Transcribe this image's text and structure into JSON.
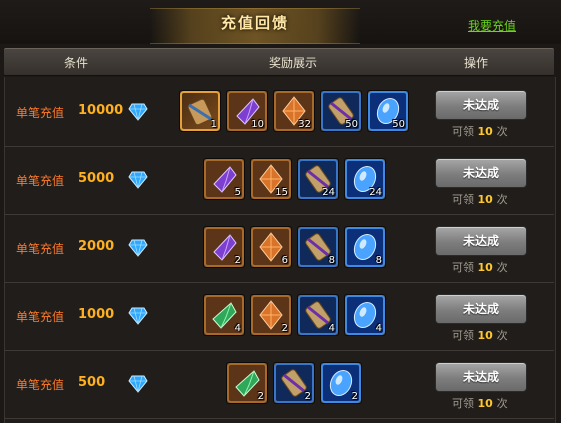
{
  "header": {
    "title": "充值回馈",
    "recharge_link": "我要充值"
  },
  "columns": {
    "condition": "条件",
    "rewards": "奖励展示",
    "action": "操作"
  },
  "rows": [
    {
      "label": "单笔充值",
      "amount": "10000",
      "button": "未达成",
      "claim_prefix": "可领",
      "claim_count": "10",
      "claim_suffix": "次",
      "rewards": [
        {
          "icon": "scroll-icon",
          "count": "1"
        },
        {
          "icon": "purple-crystal-icon",
          "count": "10"
        },
        {
          "icon": "orange-crystal-icon",
          "count": "32"
        },
        {
          "icon": "blue-scroll-icon",
          "count": "50"
        },
        {
          "icon": "blue-gem-icon",
          "count": "50"
        }
      ]
    },
    {
      "label": "单笔充值",
      "amount": "5000",
      "button": "未达成",
      "claim_prefix": "可领",
      "claim_count": "10",
      "claim_suffix": "次",
      "rewards": [
        {
          "icon": "purple-crystal-icon",
          "count": "5"
        },
        {
          "icon": "orange-crystal-icon",
          "count": "15"
        },
        {
          "icon": "blue-scroll-icon",
          "count": "24"
        },
        {
          "icon": "blue-gem-icon",
          "count": "24"
        }
      ]
    },
    {
      "label": "单笔充值",
      "amount": "2000",
      "button": "未达成",
      "claim_prefix": "可领",
      "claim_count": "10",
      "claim_suffix": "次",
      "rewards": [
        {
          "icon": "purple-crystal-icon",
          "count": "2"
        },
        {
          "icon": "orange-crystal-icon",
          "count": "6"
        },
        {
          "icon": "blue-scroll-icon",
          "count": "8"
        },
        {
          "icon": "blue-gem-icon",
          "count": "8"
        }
      ]
    },
    {
      "label": "单笔充值",
      "amount": "1000",
      "button": "未达成",
      "claim_prefix": "可领",
      "claim_count": "10",
      "claim_suffix": "次",
      "rewards": [
        {
          "icon": "green-crystal-icon",
          "count": "4"
        },
        {
          "icon": "orange-crystal-icon",
          "count": "2"
        },
        {
          "icon": "blue-scroll-icon",
          "count": "4"
        },
        {
          "icon": "blue-gem-icon",
          "count": "4"
        }
      ]
    },
    {
      "label": "单笔充值",
      "amount": "500",
      "button": "未达成",
      "claim_prefix": "可领",
      "claim_count": "10",
      "claim_suffix": "次",
      "rewards": [
        {
          "icon": "green-crystal-icon",
          "count": "2"
        },
        {
          "icon": "blue-scroll-icon",
          "count": "2"
        },
        {
          "icon": "blue-gem-icon",
          "count": "2"
        }
      ]
    }
  ],
  "colors": {
    "condition_label": "#ff7a2a",
    "amount": "#ffb020",
    "link": "#6bd41e",
    "claim_count": "#ffc830",
    "button": "#8a8a8a"
  }
}
